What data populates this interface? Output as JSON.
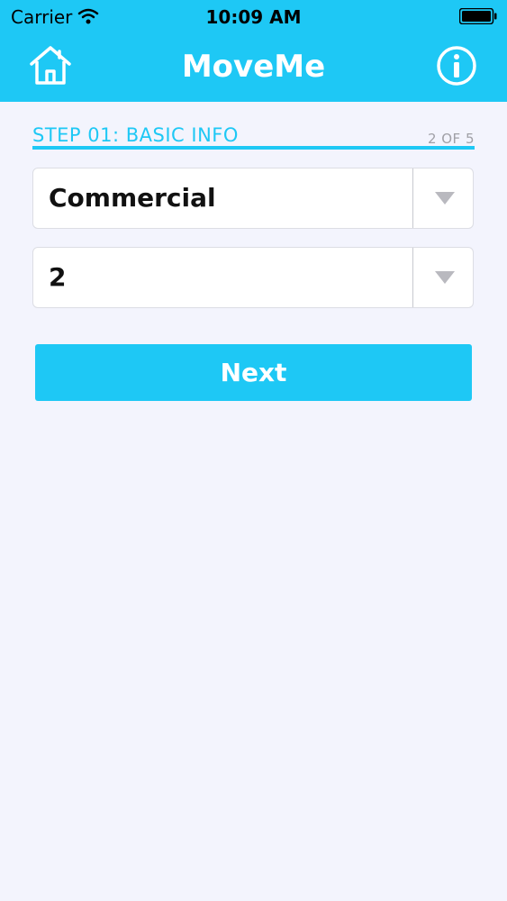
{
  "status_bar": {
    "carrier": "Carrier",
    "time": "10:09 AM",
    "wifi_icon": "wifi-icon",
    "battery_icon": "battery-icon"
  },
  "nav": {
    "title": "MoveMe",
    "home_icon": "home-icon",
    "info_icon": "info-icon"
  },
  "step": {
    "title": "STEP 01: BASIC INFO",
    "progress": "2 OF 5"
  },
  "fields": {
    "property_type": {
      "value": "Commercial",
      "dropdown_icon": "chevron-down-icon"
    },
    "quantity": {
      "value": "2",
      "dropdown_icon": "chevron-down-icon"
    }
  },
  "actions": {
    "next_label": "Next"
  },
  "colors": {
    "accent": "#1ec8f5",
    "background": "#f3f4fd",
    "field_background": "#ffffff",
    "muted_text": "#a0a0a6"
  }
}
